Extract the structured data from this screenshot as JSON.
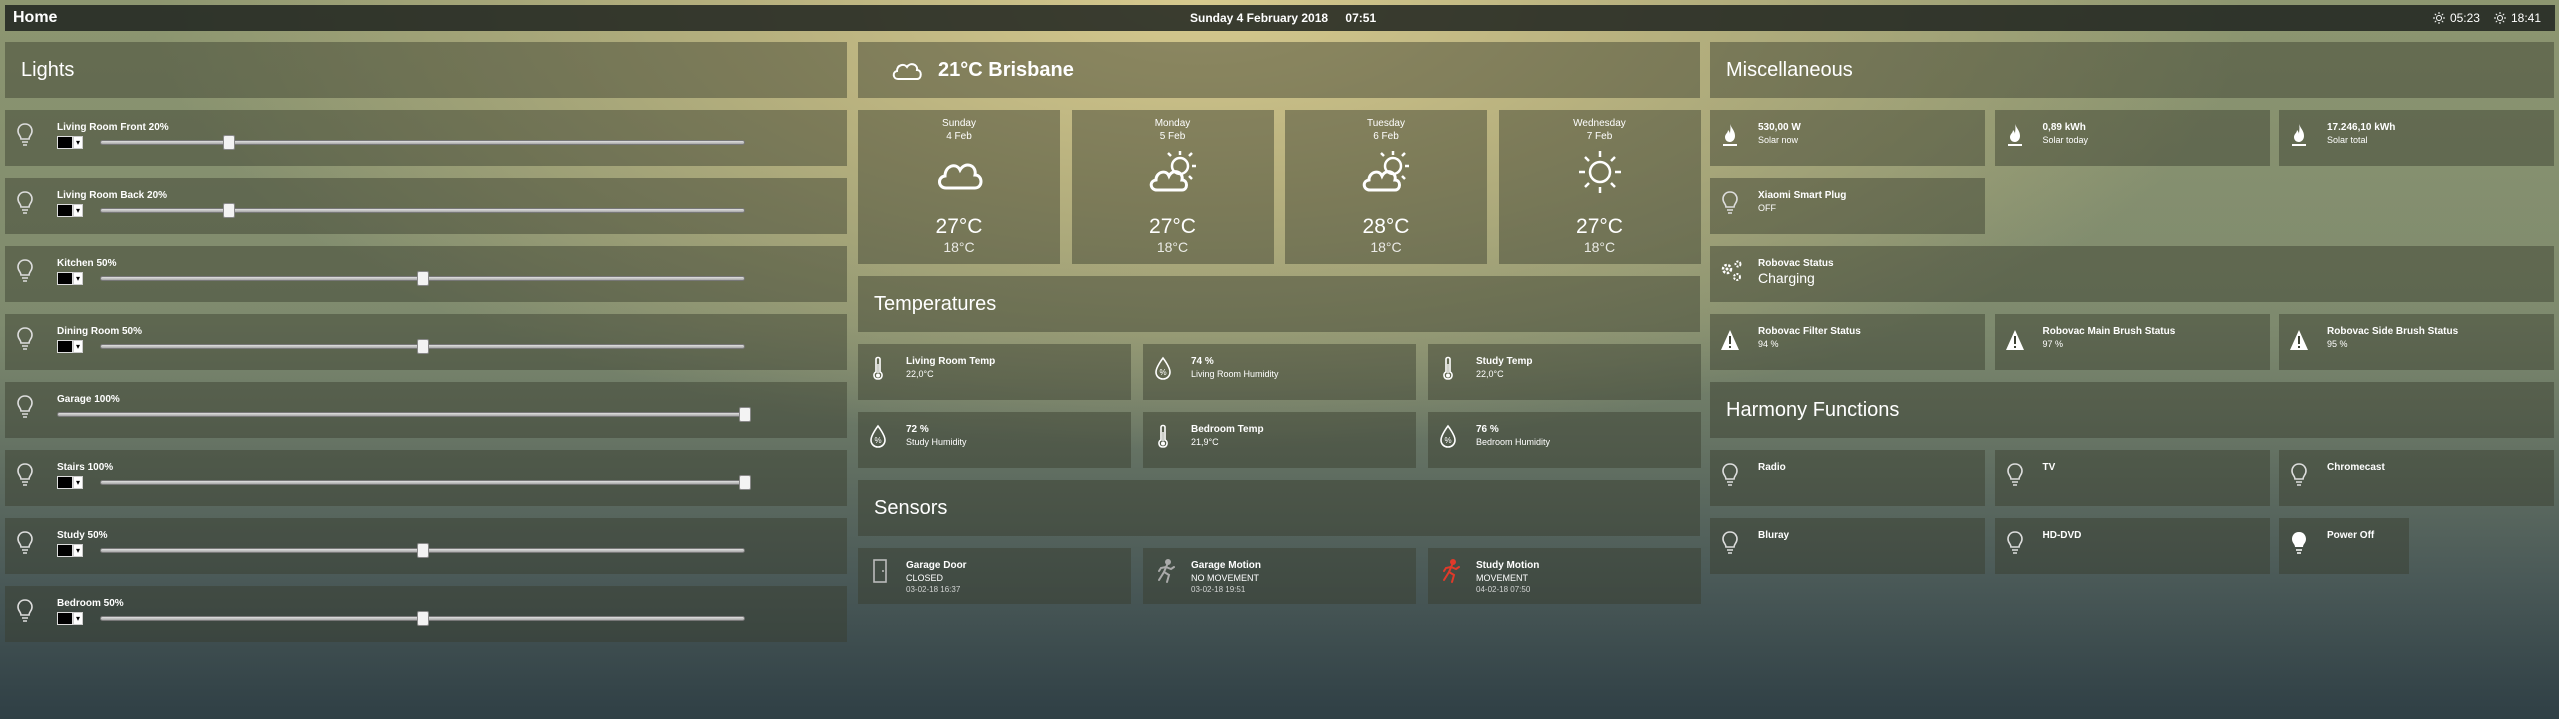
{
  "topbar": {
    "home": "Home",
    "date": "Sunday 4 February 2018",
    "time": "07:51",
    "sunrise": "05:23",
    "sunset": "18:41"
  },
  "lights": {
    "title": "Lights",
    "items": [
      {
        "label": "Living Room Front 20%",
        "level": 20,
        "has_color": true
      },
      {
        "label": "Living Room Back 20%",
        "level": 20,
        "has_color": true
      },
      {
        "label": "Kitchen 50%",
        "level": 50,
        "has_color": true
      },
      {
        "label": "Dining Room 50%",
        "level": 50,
        "has_color": true
      },
      {
        "label": "Garage 100%",
        "level": 100,
        "has_color": false
      },
      {
        "label": "Stairs 100%",
        "level": 100,
        "has_color": true
      },
      {
        "label": "Study 50%",
        "level": 50,
        "has_color": true
      },
      {
        "label": "Bedroom 50%",
        "level": 50,
        "has_color": true
      }
    ]
  },
  "weather": {
    "current": "21°C  Brisbane",
    "days": [
      {
        "day": "Sunday",
        "date": "4 Feb",
        "hi": "27°C",
        "lo": "18°C",
        "icon": "cloudy-icon"
      },
      {
        "day": "Monday",
        "date": "5 Feb",
        "hi": "27°C",
        "lo": "18°C",
        "icon": "partly-cloudy-icon"
      },
      {
        "day": "Tuesday",
        "date": "6 Feb",
        "hi": "28°C",
        "lo": "18°C",
        "icon": "partly-cloudy-icon"
      },
      {
        "day": "Wednesday",
        "date": "7 Feb",
        "hi": "27°C",
        "lo": "18°C",
        "icon": "sunny-icon"
      }
    ]
  },
  "temperatures": {
    "title": "Temperatures",
    "items": [
      {
        "name": "Living Room Temp",
        "value": "22,0°C",
        "icon": "thermometer-icon"
      },
      {
        "name": "74 %",
        "value": "Living Room Humidity",
        "icon": "humidity-icon"
      },
      {
        "name": "Study Temp",
        "value": "22,0°C",
        "icon": "thermometer-icon"
      },
      {
        "name": "72 %",
        "value": "Study Humidity",
        "icon": "humidity-icon"
      },
      {
        "name": "Bedroom Temp",
        "value": "21,9°C",
        "icon": "thermometer-icon"
      },
      {
        "name": "76 %",
        "value": "Bedroom Humidity",
        "icon": "humidity-icon"
      }
    ]
  },
  "sensors": {
    "title": "Sensors",
    "items": [
      {
        "name": "Garage Door",
        "state": "CLOSED",
        "time": "03-02-18 16:37",
        "icon": "door-icon"
      },
      {
        "name": "Garage Motion",
        "state": "NO MOVEMENT",
        "time": "03-02-18 19:51",
        "icon": "motion-icon"
      },
      {
        "name": "Study Motion",
        "state": "MOVEMENT",
        "time": "04-02-18 07:50",
        "icon": "motion-active-icon"
      }
    ]
  },
  "misc": {
    "title": "Miscellaneous",
    "solar": [
      {
        "value": "530,00 W",
        "label": "Solar now"
      },
      {
        "value": "0,89 kWh",
        "label": "Solar today"
      },
      {
        "value": "17.246,10 kWh",
        "label": "Solar total"
      }
    ],
    "plug": {
      "name": "Xiaomi Smart Plug",
      "state": "OFF"
    },
    "robovac": {
      "name": "Robovac Status",
      "state": "Charging"
    },
    "robovac_parts": [
      {
        "name": "Robovac Filter Status",
        "value": "94 %"
      },
      {
        "name": "Robovac Main Brush Status",
        "value": "97 %"
      },
      {
        "name": "Robovac Side Brush Status",
        "value": "95 %"
      }
    ]
  },
  "harmony": {
    "title": "Harmony Functions",
    "items": [
      "Radio",
      "TV",
      "Chromecast",
      "Bluray",
      "HD-DVD",
      "Power Off"
    ]
  },
  "colors": {
    "tile_bg": "rgba(55,60,45,0.45)",
    "motion_active": "#e03a2a"
  }
}
